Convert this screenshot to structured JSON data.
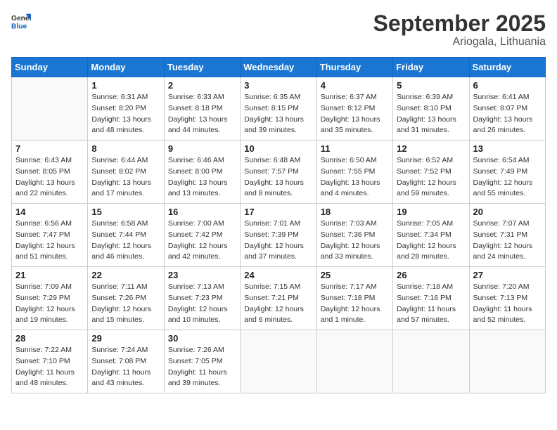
{
  "header": {
    "logo_general": "General",
    "logo_blue": "Blue",
    "month_title": "September 2025",
    "location": "Ariogala, Lithuania"
  },
  "weekdays": [
    "Sunday",
    "Monday",
    "Tuesday",
    "Wednesday",
    "Thursday",
    "Friday",
    "Saturday"
  ],
  "weeks": [
    [
      {
        "day": "",
        "info": ""
      },
      {
        "day": "1",
        "info": "Sunrise: 6:31 AM\nSunset: 8:20 PM\nDaylight: 13 hours\nand 48 minutes."
      },
      {
        "day": "2",
        "info": "Sunrise: 6:33 AM\nSunset: 8:18 PM\nDaylight: 13 hours\nand 44 minutes."
      },
      {
        "day": "3",
        "info": "Sunrise: 6:35 AM\nSunset: 8:15 PM\nDaylight: 13 hours\nand 39 minutes."
      },
      {
        "day": "4",
        "info": "Sunrise: 6:37 AM\nSunset: 8:12 PM\nDaylight: 13 hours\nand 35 minutes."
      },
      {
        "day": "5",
        "info": "Sunrise: 6:39 AM\nSunset: 8:10 PM\nDaylight: 13 hours\nand 31 minutes."
      },
      {
        "day": "6",
        "info": "Sunrise: 6:41 AM\nSunset: 8:07 PM\nDaylight: 13 hours\nand 26 minutes."
      }
    ],
    [
      {
        "day": "7",
        "info": "Sunrise: 6:43 AM\nSunset: 8:05 PM\nDaylight: 13 hours\nand 22 minutes."
      },
      {
        "day": "8",
        "info": "Sunrise: 6:44 AM\nSunset: 8:02 PM\nDaylight: 13 hours\nand 17 minutes."
      },
      {
        "day": "9",
        "info": "Sunrise: 6:46 AM\nSunset: 8:00 PM\nDaylight: 13 hours\nand 13 minutes."
      },
      {
        "day": "10",
        "info": "Sunrise: 6:48 AM\nSunset: 7:57 PM\nDaylight: 13 hours\nand 8 minutes."
      },
      {
        "day": "11",
        "info": "Sunrise: 6:50 AM\nSunset: 7:55 PM\nDaylight: 13 hours\nand 4 minutes."
      },
      {
        "day": "12",
        "info": "Sunrise: 6:52 AM\nSunset: 7:52 PM\nDaylight: 12 hours\nand 59 minutes."
      },
      {
        "day": "13",
        "info": "Sunrise: 6:54 AM\nSunset: 7:49 PM\nDaylight: 12 hours\nand 55 minutes."
      }
    ],
    [
      {
        "day": "14",
        "info": "Sunrise: 6:56 AM\nSunset: 7:47 PM\nDaylight: 12 hours\nand 51 minutes."
      },
      {
        "day": "15",
        "info": "Sunrise: 6:58 AM\nSunset: 7:44 PM\nDaylight: 12 hours\nand 46 minutes."
      },
      {
        "day": "16",
        "info": "Sunrise: 7:00 AM\nSunset: 7:42 PM\nDaylight: 12 hours\nand 42 minutes."
      },
      {
        "day": "17",
        "info": "Sunrise: 7:01 AM\nSunset: 7:39 PM\nDaylight: 12 hours\nand 37 minutes."
      },
      {
        "day": "18",
        "info": "Sunrise: 7:03 AM\nSunset: 7:36 PM\nDaylight: 12 hours\nand 33 minutes."
      },
      {
        "day": "19",
        "info": "Sunrise: 7:05 AM\nSunset: 7:34 PM\nDaylight: 12 hours\nand 28 minutes."
      },
      {
        "day": "20",
        "info": "Sunrise: 7:07 AM\nSunset: 7:31 PM\nDaylight: 12 hours\nand 24 minutes."
      }
    ],
    [
      {
        "day": "21",
        "info": "Sunrise: 7:09 AM\nSunset: 7:29 PM\nDaylight: 12 hours\nand 19 minutes."
      },
      {
        "day": "22",
        "info": "Sunrise: 7:11 AM\nSunset: 7:26 PM\nDaylight: 12 hours\nand 15 minutes."
      },
      {
        "day": "23",
        "info": "Sunrise: 7:13 AM\nSunset: 7:23 PM\nDaylight: 12 hours\nand 10 minutes."
      },
      {
        "day": "24",
        "info": "Sunrise: 7:15 AM\nSunset: 7:21 PM\nDaylight: 12 hours\nand 6 minutes."
      },
      {
        "day": "25",
        "info": "Sunrise: 7:17 AM\nSunset: 7:18 PM\nDaylight: 12 hours\nand 1 minute."
      },
      {
        "day": "26",
        "info": "Sunrise: 7:18 AM\nSunset: 7:16 PM\nDaylight: 11 hours\nand 57 minutes."
      },
      {
        "day": "27",
        "info": "Sunrise: 7:20 AM\nSunset: 7:13 PM\nDaylight: 11 hours\nand 52 minutes."
      }
    ],
    [
      {
        "day": "28",
        "info": "Sunrise: 7:22 AM\nSunset: 7:10 PM\nDaylight: 11 hours\nand 48 minutes."
      },
      {
        "day": "29",
        "info": "Sunrise: 7:24 AM\nSunset: 7:08 PM\nDaylight: 11 hours\nand 43 minutes."
      },
      {
        "day": "30",
        "info": "Sunrise: 7:26 AM\nSunset: 7:05 PM\nDaylight: 11 hours\nand 39 minutes."
      },
      {
        "day": "",
        "info": ""
      },
      {
        "day": "",
        "info": ""
      },
      {
        "day": "",
        "info": ""
      },
      {
        "day": "",
        "info": ""
      }
    ]
  ]
}
